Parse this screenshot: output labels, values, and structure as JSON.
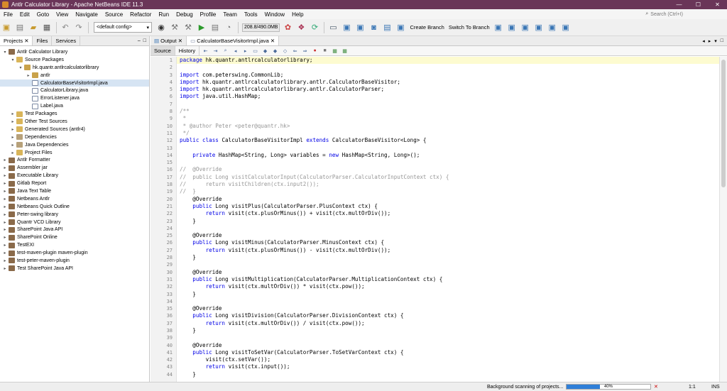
{
  "window": {
    "title": "Antlr Calculator Library - Apache NetBeans IDE 11.3"
  },
  "menu": [
    "File",
    "Edit",
    "Goto",
    "View",
    "Navigate",
    "Source",
    "Refactor",
    "Run",
    "Debug",
    "Profile",
    "Team",
    "Tools",
    "Window",
    "Help"
  ],
  "search": {
    "placeholder": "Search (Ctrl+I)"
  },
  "toolbar": {
    "config": "<default config>",
    "memory": "208.8/490.0MB",
    "create_branch": "Create Branch",
    "switch_branch": "Switch To Branch"
  },
  "left_tabs": [
    "Projects",
    "Files",
    "Services"
  ],
  "tree": [
    {
      "label": "Antlr Calculator Library",
      "level": 0,
      "toggle": "▾",
      "icon": "cup",
      "selected": false
    },
    {
      "label": "Source Packages",
      "level": 1,
      "toggle": "▾",
      "icon": "folder",
      "selected": false
    },
    {
      "label": "hk.quantr.antlrcalculatorlibrary",
      "level": 2,
      "toggle": "▾",
      "icon": "pkg",
      "selected": false
    },
    {
      "label": "antlr",
      "level": 3,
      "toggle": "▸",
      "icon": "pkg",
      "selected": false
    },
    {
      "label": "CalculatorBaseVisitorImpl.java",
      "level": 3,
      "toggle": "",
      "icon": "java",
      "selected": true
    },
    {
      "label": "CalculatorLibrary.java",
      "level": 3,
      "toggle": "",
      "icon": "java",
      "selected": false
    },
    {
      "label": "ErrorListener.java",
      "level": 3,
      "toggle": "",
      "icon": "java",
      "selected": false
    },
    {
      "label": "Label.java",
      "level": 3,
      "toggle": "",
      "icon": "java",
      "selected": false
    },
    {
      "label": "Test Packages",
      "level": 1,
      "toggle": "▸",
      "icon": "folder",
      "selected": false
    },
    {
      "label": "Other Test Sources",
      "level": 1,
      "toggle": "▸",
      "icon": "folder",
      "selected": false
    },
    {
      "label": "Generated Sources (antlr4)",
      "level": 1,
      "toggle": "▸",
      "icon": "folder",
      "selected": false
    },
    {
      "label": "Dependencies",
      "level": 1,
      "toggle": "▸",
      "icon": "lib",
      "selected": false
    },
    {
      "label": "Java Dependencies",
      "level": 1,
      "toggle": "▸",
      "icon": "lib",
      "selected": false
    },
    {
      "label": "Project Files",
      "level": 1,
      "toggle": "▸",
      "icon": "folder",
      "selected": false
    },
    {
      "label": "Antlr Formatter",
      "level": 0,
      "toggle": "▸",
      "icon": "cup",
      "selected": false
    },
    {
      "label": "Assembler jar",
      "level": 0,
      "toggle": "▸",
      "icon": "cup",
      "selected": false
    },
    {
      "label": "Executable Library",
      "level": 0,
      "toggle": "▸",
      "icon": "cup",
      "selected": false
    },
    {
      "label": "Gitlab Report",
      "level": 0,
      "toggle": "▸",
      "icon": "cup",
      "selected": false
    },
    {
      "label": "Java Text Table",
      "level": 0,
      "toggle": "▸",
      "icon": "cup",
      "selected": false
    },
    {
      "label": "Netbeans Antlr",
      "level": 0,
      "toggle": "▸",
      "icon": "cup",
      "selected": false
    },
    {
      "label": "Netbeans Quick Outline",
      "level": 0,
      "toggle": "▸",
      "icon": "cup",
      "selected": false
    },
    {
      "label": "Peter-swing library",
      "level": 0,
      "toggle": "▸",
      "icon": "cup",
      "selected": false
    },
    {
      "label": "Quantr VCD Library",
      "level": 0,
      "toggle": "▸",
      "icon": "cup",
      "selected": false
    },
    {
      "label": "SharePoint Java API",
      "level": 0,
      "toggle": "▸",
      "icon": "cup",
      "selected": false
    },
    {
      "label": "SharePoint Online",
      "level": 0,
      "toggle": "▸",
      "icon": "cup",
      "selected": false
    },
    {
      "label": "TestEXI",
      "level": 0,
      "toggle": "▸",
      "icon": "cup",
      "selected": false
    },
    {
      "label": "test-maven-plugin maven-plugin",
      "level": 0,
      "toggle": "▸",
      "icon": "cup",
      "selected": false
    },
    {
      "label": "test-peter-maven-plugin",
      "level": 0,
      "toggle": "▸",
      "icon": "cup",
      "selected": false
    },
    {
      "label": "Test SharePoint Java API",
      "level": 0,
      "toggle": "▸",
      "icon": "cup",
      "selected": false
    }
  ],
  "editor": {
    "output_tab": "Output",
    "file_tab": "CalculatorBaseVisitorImpl.java",
    "source_tab": "Source",
    "history_tab": "History",
    "lines": [
      {
        "n": "1",
        "segs": [
          {
            "t": "kw",
            "v": "package"
          },
          {
            "t": "",
            "v": " hk.quantr.antlrcalculatorlibrary;"
          }
        ],
        "hl": true
      },
      {
        "n": "2",
        "segs": []
      },
      {
        "n": "3",
        "segs": [
          {
            "t": "kw",
            "v": "import"
          },
          {
            "t": "",
            "v": " com.peterswing.CommonLib;"
          }
        ]
      },
      {
        "n": "4",
        "segs": [
          {
            "t": "kw",
            "v": "import"
          },
          {
            "t": "",
            "v": " hk.quantr.antlrcalculatorlibrary.antlr.CalculatorBaseVisitor;"
          }
        ]
      },
      {
        "n": "5",
        "segs": [
          {
            "t": "kw",
            "v": "import"
          },
          {
            "t": "",
            "v": " hk.quantr.antlrcalculatorlibrary.antlr.CalculatorParser;"
          }
        ]
      },
      {
        "n": "6",
        "segs": [
          {
            "t": "kw",
            "v": "import"
          },
          {
            "t": "",
            "v": " java.util.HashMap;"
          }
        ]
      },
      {
        "n": "7",
        "segs": []
      },
      {
        "n": "8",
        "segs": [
          {
            "t": "cm",
            "v": "/**"
          }
        ]
      },
      {
        "n": "9",
        "segs": [
          {
            "t": "cm",
            "v": " *"
          }
        ]
      },
      {
        "n": "10",
        "segs": [
          {
            "t": "cm",
            "v": " * @author Peter <peter@quantr.hk>"
          }
        ]
      },
      {
        "n": "11",
        "segs": [
          {
            "t": "cm",
            "v": " */"
          }
        ]
      },
      {
        "n": "12",
        "segs": [
          {
            "t": "kw",
            "v": "public class"
          },
          {
            "t": "",
            "v": " CalculatorBaseVisitorImpl "
          },
          {
            "t": "kw",
            "v": "extends"
          },
          {
            "t": "",
            "v": " CalculatorBaseVisitor<Long> {"
          }
        ]
      },
      {
        "n": "13",
        "segs": []
      },
      {
        "n": "14",
        "segs": [
          {
            "t": "",
            "v": "    "
          },
          {
            "t": "kw",
            "v": "private"
          },
          {
            "t": "",
            "v": " HashMap<String, Long> variables = "
          },
          {
            "t": "kw",
            "v": "new"
          },
          {
            "t": "",
            "v": " HashMap<String, Long>();"
          }
        ]
      },
      {
        "n": "15",
        "segs": []
      },
      {
        "n": "16",
        "segs": [
          {
            "t": "cm",
            "v": "//  @Override"
          }
        ]
      },
      {
        "n": "17",
        "segs": [
          {
            "t": "cm",
            "v": "//  public Long visitCalculatorInput(CalculatorParser.CalculatorInputContext ctx) {"
          }
        ]
      },
      {
        "n": "18",
        "segs": [
          {
            "t": "cm",
            "v": "//      return visitChildren(ctx.input2());"
          }
        ]
      },
      {
        "n": "19",
        "segs": [
          {
            "t": "cm",
            "v": "//  }"
          }
        ]
      },
      {
        "n": "20",
        "segs": [
          {
            "t": "",
            "v": "    @Override"
          }
        ]
      },
      {
        "n": "21",
        "segs": [
          {
            "t": "",
            "v": "    "
          },
          {
            "t": "kw",
            "v": "public"
          },
          {
            "t": "",
            "v": " Long visitPlus(CalculatorParser.PlusContext ctx) {"
          }
        ]
      },
      {
        "n": "22",
        "segs": [
          {
            "t": "",
            "v": "        "
          },
          {
            "t": "kw",
            "v": "return"
          },
          {
            "t": "",
            "v": " visit(ctx.plusOrMinus()) + visit(ctx.multOrDiv());"
          }
        ]
      },
      {
        "n": "23",
        "segs": [
          {
            "t": "",
            "v": "    }"
          }
        ]
      },
      {
        "n": "24",
        "segs": []
      },
      {
        "n": "25",
        "segs": [
          {
            "t": "",
            "v": "    @Override"
          }
        ]
      },
      {
        "n": "26",
        "segs": [
          {
            "t": "",
            "v": "    "
          },
          {
            "t": "kw",
            "v": "public"
          },
          {
            "t": "",
            "v": " Long visitMinus(CalculatorParser.MinusContext ctx) {"
          }
        ]
      },
      {
        "n": "27",
        "segs": [
          {
            "t": "",
            "v": "        "
          },
          {
            "t": "kw",
            "v": "return"
          },
          {
            "t": "",
            "v": " visit(ctx.plusOrMinus()) - visit(ctx.multOrDiv());"
          }
        ]
      },
      {
        "n": "28",
        "segs": [
          {
            "t": "",
            "v": "    }"
          }
        ]
      },
      {
        "n": "29",
        "segs": []
      },
      {
        "n": "30",
        "segs": [
          {
            "t": "",
            "v": "    @Override"
          }
        ]
      },
      {
        "n": "31",
        "segs": [
          {
            "t": "",
            "v": "    "
          },
          {
            "t": "kw",
            "v": "public"
          },
          {
            "t": "",
            "v": " Long visitMultiplication(CalculatorParser.MultiplicationContext ctx) {"
          }
        ]
      },
      {
        "n": "32",
        "segs": [
          {
            "t": "",
            "v": "        "
          },
          {
            "t": "kw",
            "v": "return"
          },
          {
            "t": "",
            "v": " visit(ctx.multOrDiv()) * visit(ctx.pow());"
          }
        ]
      },
      {
        "n": "33",
        "segs": [
          {
            "t": "",
            "v": "    }"
          }
        ]
      },
      {
        "n": "34",
        "segs": []
      },
      {
        "n": "35",
        "segs": [
          {
            "t": "",
            "v": "    @Override"
          }
        ]
      },
      {
        "n": "36",
        "segs": [
          {
            "t": "",
            "v": "    "
          },
          {
            "t": "kw",
            "v": "public"
          },
          {
            "t": "",
            "v": " Long visitDivision(CalculatorParser.DivisionContext ctx) {"
          }
        ]
      },
      {
        "n": "37",
        "segs": [
          {
            "t": "",
            "v": "        "
          },
          {
            "t": "kw",
            "v": "return"
          },
          {
            "t": "",
            "v": " visit(ctx.multOrDiv()) / visit(ctx.pow());"
          }
        ]
      },
      {
        "n": "38",
        "segs": [
          {
            "t": "",
            "v": "    }"
          }
        ]
      },
      {
        "n": "39",
        "segs": []
      },
      {
        "n": "40",
        "segs": [
          {
            "t": "",
            "v": "    @Override"
          }
        ]
      },
      {
        "n": "41",
        "segs": [
          {
            "t": "",
            "v": "    "
          },
          {
            "t": "kw",
            "v": "public"
          },
          {
            "t": "",
            "v": " Long visitToSetVar(CalculatorParser.ToSetVarContext ctx) {"
          }
        ]
      },
      {
        "n": "42",
        "segs": [
          {
            "t": "",
            "v": "        visit(ctx.setVar());"
          }
        ]
      },
      {
        "n": "43",
        "segs": [
          {
            "t": "",
            "v": "        "
          },
          {
            "t": "kw",
            "v": "return"
          },
          {
            "t": "",
            "v": " visit(ctx.input());"
          }
        ]
      },
      {
        "n": "44",
        "segs": [
          {
            "t": "",
            "v": "    }"
          }
        ]
      }
    ]
  },
  "status": {
    "task": "Background scanning of projects...",
    "progress_label": "40%",
    "progress": 0.4,
    "position": "1:1",
    "mode": "INS"
  },
  "colors": {
    "titlebar": "#6a3558",
    "keyword": "#0000e6",
    "comment": "#969696",
    "progress": "#2f7fd8"
  }
}
